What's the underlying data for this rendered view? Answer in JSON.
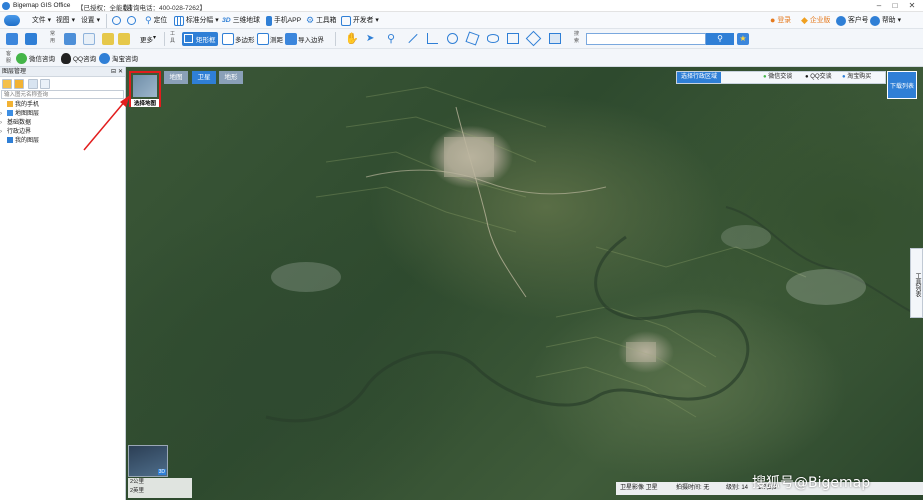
{
  "window": {
    "title": "Bigemap GIS Office",
    "license": "【已授权：全能版】",
    "hotline": "【咨询电话：400-028-7262】"
  },
  "menu": {
    "items": [
      "文件",
      "视图",
      "设置",
      "定位",
      "标准分幅",
      "三维地球",
      "手机APP",
      "工具箱",
      "开发者"
    ],
    "login": "登录",
    "enterprise": "企业版",
    "client": "客户号",
    "help": "帮助"
  },
  "toolbar1": {
    "group1_label": "常用",
    "group2_label": "工具",
    "more": "更多",
    "rect_select": "矩形框",
    "polygon": "多边形",
    "measure": "测距",
    "import_boundary": "导入边界",
    "search_label": "搜索",
    "search_placeholder": ""
  },
  "toolbar2": {
    "group_label": "客服",
    "wechat": "微信咨询",
    "qq": "QQ咨询",
    "taobao": "淘宝咨询"
  },
  "left_panel": {
    "title": "图层管理",
    "search_placeholder": "输入图元名称查询",
    "tree": [
      {
        "label": "我的手机",
        "expandable": false,
        "icon_color": "#f2b233"
      },
      {
        "label": "地图图层",
        "expandable": true,
        "icon_color": "#3d8ee3"
      },
      {
        "label": "基础数据",
        "expandable": true,
        "icon_color": "#6a7a8c"
      },
      {
        "label": "行政边界",
        "expandable": true,
        "icon_color": "#6a7a8c"
      },
      {
        "label": "我的图层",
        "expandable": false,
        "icon_color": "#2f7fd6"
      }
    ]
  },
  "map": {
    "tabs": [
      "地图",
      "卫星",
      "地形"
    ],
    "active_tab": "卫星",
    "layer_select_label": "选择地图",
    "region_select": "选择行政区域",
    "wechat_trade": "微信交谈",
    "qq_trade": "QQ交谈",
    "taobao_buy": "淘宝购买",
    "download_list": "下载列表",
    "tool_list": "工具列表",
    "minimap_tag": "3D",
    "scale_top": "2公里",
    "scale_bottom": "2英里",
    "status": {
      "source": "卫星影像 卫星",
      "capture_time": "拍摄时间: 无",
      "level": "级别: 14",
      "extra": "1:7,5,6"
    }
  },
  "watermark": "搜狐号@Bigemap",
  "colors": {
    "accent": "#2f7fd6",
    "highlight_red": "#e21d1d",
    "panel_bg": "#f3f6fa"
  }
}
